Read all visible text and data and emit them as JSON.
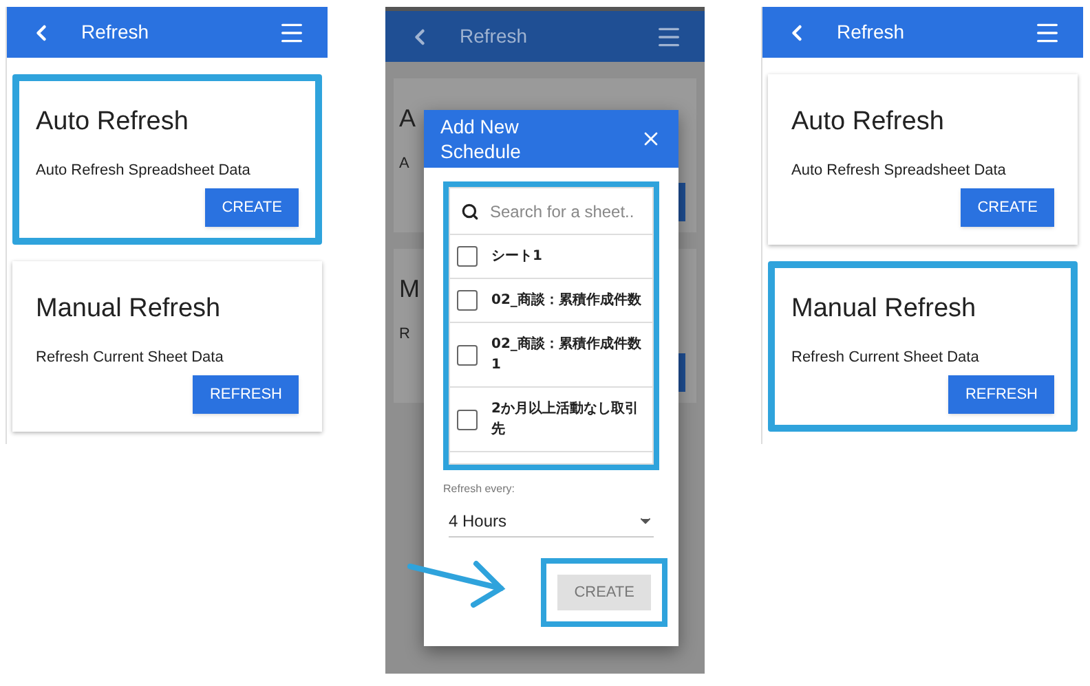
{
  "screens": [
    {
      "kind": "list",
      "header": {
        "title": "Refresh"
      },
      "cards": [
        {
          "title": "Auto Refresh",
          "description": "Auto Refresh Spreadsheet Data",
          "button": "CREATE",
          "highlighted": true
        },
        {
          "title": "Manual Refresh",
          "description": "Refresh Current Sheet Data",
          "button": "REFRESH",
          "highlighted": false
        }
      ]
    },
    {
      "kind": "dialog",
      "header": {
        "title": "Refresh"
      },
      "background_cards": [
        {
          "title": "A",
          "description": "A"
        },
        {
          "title": "M",
          "description": "R"
        }
      ],
      "dialog": {
        "title": "Add New Schedule",
        "search": {
          "placeholder": "Search for a sheet.."
        },
        "list_highlighted": true,
        "sheets": [
          {
            "label": "シート1",
            "checked": false
          },
          {
            "label": "02_商談：累積作成件数",
            "checked": false
          },
          {
            "label": "02_商談：累積作成件数1",
            "checked": false
          },
          {
            "label": "2か月以上活動なし取引先",
            "checked": false
          }
        ],
        "refresh_label": "Refresh every:",
        "refresh_value": "4 Hours",
        "button": "CREATE",
        "button_highlighted": true
      }
    },
    {
      "kind": "list",
      "header": {
        "title": "Refresh"
      },
      "cards": [
        {
          "title": "Auto Refresh",
          "description": "Auto Refresh Spreadsheet Data",
          "button": "CREATE",
          "highlighted": false
        },
        {
          "title": "Manual Refresh",
          "description": "Refresh Current Sheet Data",
          "button": "REFRESH",
          "highlighted": true
        }
      ]
    }
  ]
}
